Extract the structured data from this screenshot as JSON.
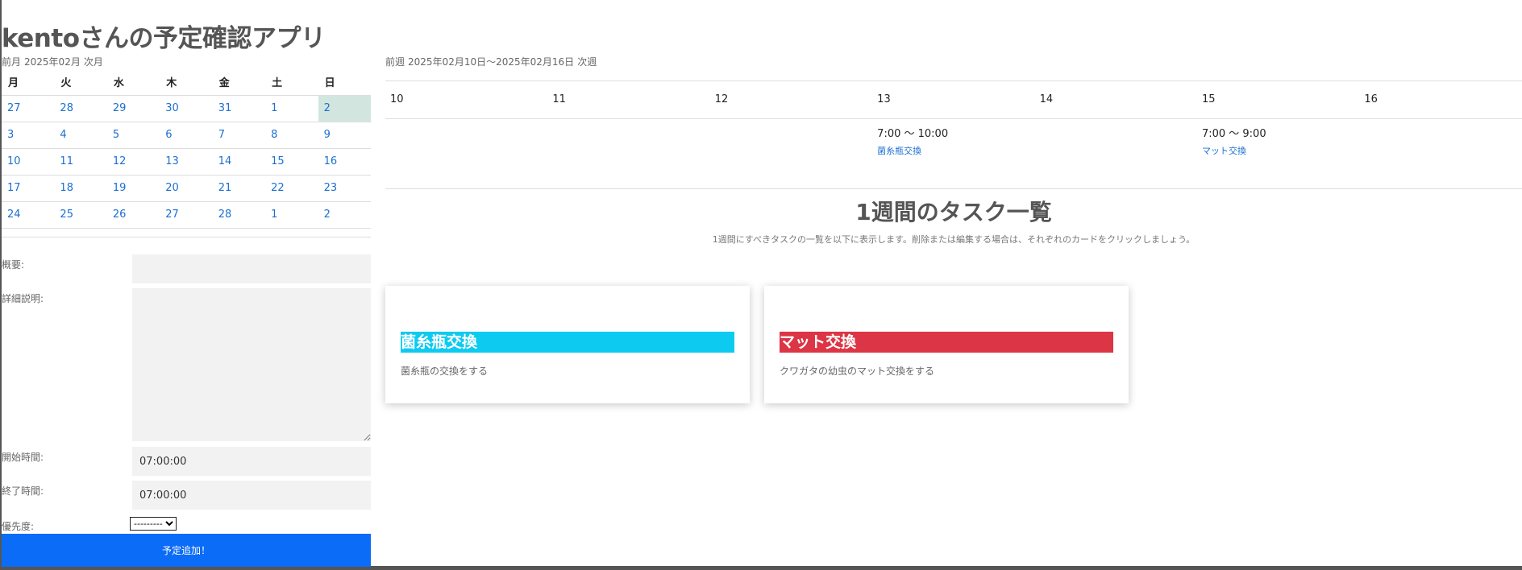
{
  "app": {
    "title": "kentoさんの予定確認アプリ"
  },
  "month": {
    "prev": "前月",
    "current": "2025年02月",
    "next": "次月",
    "weekdays": [
      "月",
      "火",
      "水",
      "木",
      "金",
      "土",
      "日"
    ],
    "weeks": [
      [
        "27",
        "28",
        "29",
        "30",
        "31",
        "1",
        "2"
      ],
      [
        "3",
        "4",
        "5",
        "6",
        "7",
        "8",
        "9"
      ],
      [
        "10",
        "11",
        "12",
        "13",
        "14",
        "15",
        "16"
      ],
      [
        "17",
        "18",
        "19",
        "20",
        "21",
        "22",
        "23"
      ],
      [
        "24",
        "25",
        "26",
        "27",
        "28",
        "1",
        "2"
      ]
    ]
  },
  "form": {
    "summary_label": "概要:",
    "summary_value": "",
    "detail_label": "詳細説明:",
    "detail_value": "",
    "start_label": "開始時間:",
    "start_value": "07:00:00",
    "end_label": "終了時間:",
    "end_value": "07:00:00",
    "priority_label": "優先度:",
    "priority_value": "---------",
    "submit_label": "予定追加！"
  },
  "week": {
    "prev": "前週",
    "range": "2025年02月10日～2025年02月16日",
    "next": "次週",
    "days": [
      "10",
      "11",
      "12",
      "13",
      "14",
      "15",
      "16"
    ],
    "events": [
      {
        "day_index": 3,
        "time": "7:00 ～ 10:00",
        "title": "菌糸瓶交換"
      },
      {
        "day_index": 5,
        "time": "7:00 ～ 9:00",
        "title": "マット交換"
      }
    ]
  },
  "tasks": {
    "title": "1週間のタスク一覧",
    "description": "1週間にすべきタスクの一覧を以下に表示します。削除または編集する場合は、それぞれのカードをクリックしましょう。",
    "cards": [
      {
        "title": "菌糸瓶交換",
        "description": "菌糸瓶の交換をする",
        "color": "#0dcaf0"
      },
      {
        "title": "マット交換",
        "description": "クワガタの幼虫のマット交換をする",
        "color": "#dc3545"
      }
    ]
  },
  "colors": {
    "primary": "#0b6cf7",
    "link": "#1a6fd1",
    "today_highlight": "#d2e6df"
  }
}
